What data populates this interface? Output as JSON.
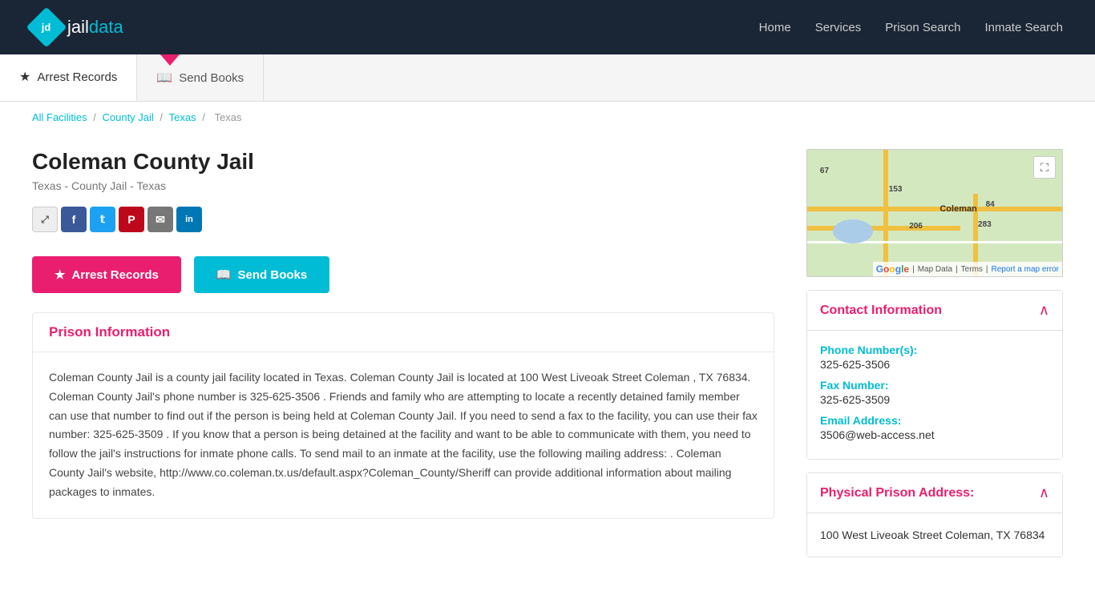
{
  "header": {
    "logo_text_jd": "jd",
    "logo_text_jail": "jail",
    "logo_text_data": "data",
    "nav": {
      "home": "Home",
      "services": "Services",
      "prison_search": "Prison Search",
      "inmate_search": "Inmate Search"
    }
  },
  "tabs": {
    "arrest_records": "Arrest Records",
    "send_books": "Send Books"
  },
  "breadcrumb": {
    "all_facilities": "All Facilities",
    "county_jail": "County Jail",
    "texas": "Texas",
    "current": "Texas"
  },
  "facility": {
    "name": "Coleman County Jail",
    "subtitle": "Texas - County Jail - Texas"
  },
  "social": {
    "share": "⤢",
    "facebook": "f",
    "twitter": "t",
    "pinterest": "P",
    "email": "✉",
    "linkedin": "in"
  },
  "buttons": {
    "arrest_records": "Arrest Records",
    "send_books": "Send Books"
  },
  "prison_info": {
    "title": "Prison Information",
    "body": "Coleman County Jail is a county jail facility located in Texas. Coleman County Jail is located at 100 West Liveoak Street Coleman , TX 76834. Coleman County Jail's phone number is 325-625-3506 . Friends and family who are attempting to locate a recently detained family member can use that number to find out if the person is being held at Coleman County Jail. If you need to send a fax to the facility, you can use their fax number: 325-625-3509 . If you know that a person is being detained at the facility and want to be able to communicate with them, you need to follow the jail's instructions for inmate phone calls. To send mail to an inmate at the facility, use the following mailing address: . Coleman County Jail's website, http://www.co.coleman.tx.us/default.aspx?Coleman_County/Sheriff can provide additional information about mailing packages to inmates."
  },
  "contact": {
    "section_title": "Contact Information",
    "phone_label": "Phone Number(s):",
    "phone_value": "325-625-3506",
    "fax_label": "Fax Number:",
    "fax_value": "325-625-3509",
    "email_label": "Email Address:",
    "email_value": "3506@web-access.net"
  },
  "address": {
    "section_title": "Physical Prison Address:",
    "value": "100 West Liveoak Street Coleman, TX 76834"
  },
  "map": {
    "label": "Coleman",
    "road_84": "84",
    "road_153": "153",
    "road_283": "283",
    "road_206": "206",
    "road_67": "67",
    "fullscreen_icon": "⛶",
    "google_text": "Google",
    "map_data": "Map Data",
    "terms": "Terms",
    "report": "Report a map error"
  }
}
